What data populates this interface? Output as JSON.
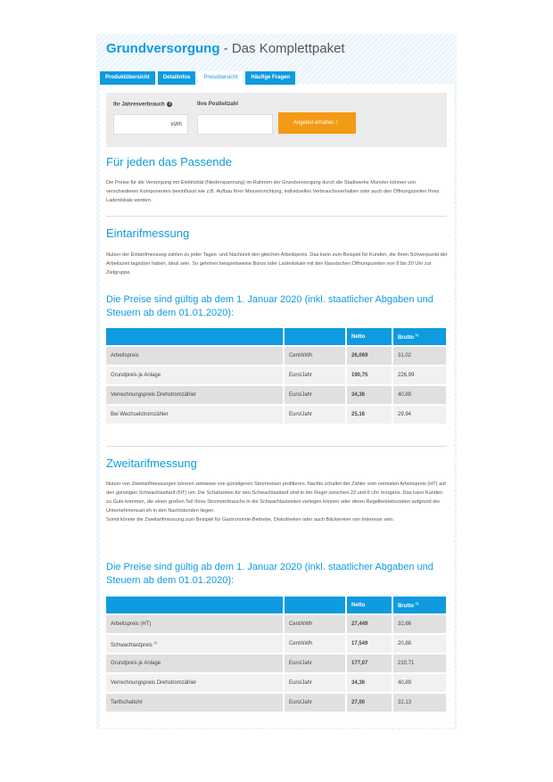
{
  "header": {
    "title_brand": "Grundversorgung",
    "title_rest": " - Das Komplettpaket"
  },
  "tabs": [
    {
      "label": "Produktübersicht"
    },
    {
      "label": "Detailinfos"
    },
    {
      "label": "Preisübersicht"
    },
    {
      "label": "Häufige Fragen"
    }
  ],
  "calculator": {
    "consumption_label": "Ihr Jahresverbrauch",
    "info_glyph": "i",
    "unit": "kWh",
    "postal_label": "Ihre Postleitzahl",
    "offer_button": "Angebot erhalten",
    "offer_arrow": "〉"
  },
  "intro": {
    "heading": "Für jeden das Passende",
    "text": "Die Preise für die Versorgung mit Elektrizität (Niederspannung) im Rahmen der Grundversorgung durch die Stadtwerke Münster können von verschiedenen Komponenten beeinflusst wie z.B. Aufbau Ihrer Messeinrichtung, individuelles Verbrauchsverhalten oder auch den Öffnungszeiten Ihres Ladenlokals werden."
  },
  "eintarif": {
    "heading": "Eintarifmessung",
    "text": "Nutzer der Eintarifmessung zahlen zu jeder Tages- und Nachtzeit den gleichen Arbeitspreis. Das kann zum Beispiel für Kunden, die Ihren Schwerpunkt der Arbeitszeit tagsüber haben, ideal sein. So gehören beispielsweise Büros oder Ladenlokale mit den klassischen Öffnungszeiten von 8 bis 20 Uhr zur Zielgruppe.",
    "price_heading": "Die Preise sind gültig ab dem 1. Januar 2020 (inkl. staatlicher Abgaben und Steuern ab dem 01.01.2020):",
    "columns": [
      "",
      "",
      "Netto",
      "Brutto",
      "1)"
    ],
    "rows": [
      {
        "name": "Arbeitspreis",
        "sup": "",
        "unit": "Cent/kWh",
        "net": "26,069",
        "gross": "31,02"
      },
      {
        "name": "Grundpreis je Anlage",
        "sup": "",
        "unit": "Euro/Jahr",
        "net": "190,75",
        "gross": "226,99"
      },
      {
        "name": "Verrechnungspreis Drehstromzähler",
        "sup": "",
        "unit": "Euro/Jahr",
        "net": "34,36",
        "gross": "40,89"
      },
      {
        "name": "Bei Wechselstromzähler",
        "sup": "",
        "unit": "Euro/Jahr",
        "net": "25,16",
        "gross": "29,94"
      }
    ]
  },
  "zweitarif": {
    "heading": "Zweitarifmessung",
    "text": "Nutzer von Zweitarifmessungen können zeitweise von günstigeren Stromreisen profitieren. Nachts schaltet der Zähler vom normalen Arbeitspreis (HT) auf den günstigen Schwachlasttarif (NT) um. Die Schaltzeiten für den Schwachlasttarif sind in der Regel zwischen 22 und 6 Uhr morgens. Das kann Kunden zu Gute kommen, die einen großen Teil Ihres Stromverbrauchs in die Schwachlastzeiten verlegen können oder deren Regelbetriebszeiten aufgrund der Unternehmensart eh in den Nachtstunden liegen.",
    "text2": "Somit könnte die Zweitarifmessung zum Beispiel für Gastronomie-Betriebe, Diskotheken oder auch Bäckereien von Interesse sein.",
    "price_heading": "Die Preise sind gültig ab dem 1. Januar 2020 (inkl. staatlicher Abgaben und Steuern ab dem 01.01.2020):",
    "columns": [
      "",
      "",
      "Netto",
      "Brutto",
      "1)"
    ],
    "rows": [
      {
        "name": "Arbeitspreis (HT)",
        "sup": "",
        "unit": "Cent/kWh",
        "net": "27,449",
        "gross": "32,66"
      },
      {
        "name": "Schwachlastpreis",
        "sup": "2)",
        "unit": "Cent/kWh",
        "net": "17,549",
        "gross": "20,88"
      },
      {
        "name": "Grundpreis je Anlage",
        "sup": "",
        "unit": "Euro/Jahr",
        "net": "177,07",
        "gross": "210,71"
      },
      {
        "name": "Verrechnungspreis Drehstromzähler",
        "sup": "",
        "unit": "Euro/Jahr",
        "net": "34,36",
        "gross": "40,89"
      },
      {
        "name": "Tarifschaltuhr",
        "sup": "",
        "unit": "Euro/Jahr",
        "net": "27,00",
        "gross": "32,13"
      }
    ]
  }
}
